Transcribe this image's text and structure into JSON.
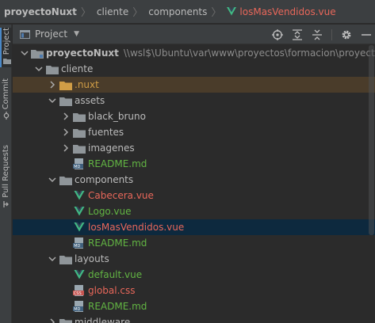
{
  "breadcrumb": {
    "items": [
      "proyectoNuxt",
      "cliente",
      "components",
      "losMasVendidos.vue"
    ]
  },
  "tool_strip": {
    "tabs": [
      "Project",
      "Commit",
      "Pull Requests"
    ]
  },
  "project_panel": {
    "title": "Project",
    "header_icons": [
      "locate-icon",
      "expand-all-icon",
      "collapse-all-icon",
      "gear-icon",
      "hide-icon"
    ]
  },
  "tree": {
    "root_name": "proyectoNuxt",
    "root_path": "\\\\wsl$\\Ubuntu\\var\\www\\proyectos\\formacion\\proyectoNu",
    "rows": [
      {
        "label": "cliente"
      },
      {
        "label": ".nuxt"
      },
      {
        "label": "assets"
      },
      {
        "label": "black_bruno"
      },
      {
        "label": "fuentes"
      },
      {
        "label": "imagenes"
      },
      {
        "label": "README.md"
      },
      {
        "label": "components"
      },
      {
        "label": "Cabecera.vue"
      },
      {
        "label": "Logo.vue"
      },
      {
        "label": "losMasVendidos.vue"
      },
      {
        "label": "README.md"
      },
      {
        "label": "layouts"
      },
      {
        "label": "default.vue"
      },
      {
        "label": "global.css"
      },
      {
        "label": "README.md"
      },
      {
        "label": "middleware"
      }
    ]
  },
  "colors": {
    "background": "#2b2b2b",
    "panel": "#3c3f41",
    "selection": "#0d293e",
    "vue_green": "#41b883",
    "modified_red": "#e8675a",
    "added_green": "#62b543",
    "excluded_orange": "#d09d46"
  }
}
